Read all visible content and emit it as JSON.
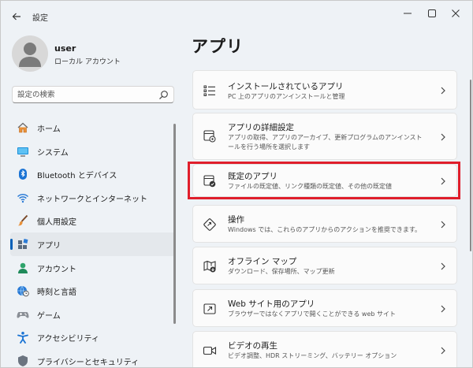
{
  "window": {
    "title": "設定"
  },
  "profile": {
    "name": "user",
    "account_type": "ローカル アカウント"
  },
  "search": {
    "placeholder": "設定の検索"
  },
  "sidebar": {
    "items": [
      {
        "label": "ホーム",
        "icon": "home-icon"
      },
      {
        "label": "システム",
        "icon": "monitor-icon"
      },
      {
        "label": "Bluetooth とデバイス",
        "icon": "bluetooth-icon"
      },
      {
        "label": "ネットワークとインターネット",
        "icon": "wifi-icon"
      },
      {
        "label": "個人用設定",
        "icon": "brush-icon"
      },
      {
        "label": "アプリ",
        "icon": "apps-icon",
        "active": true
      },
      {
        "label": "アカウント",
        "icon": "person-icon"
      },
      {
        "label": "時刻と言語",
        "icon": "globe-clock-icon"
      },
      {
        "label": "ゲーム",
        "icon": "gamepad-icon"
      },
      {
        "label": "アクセシビリティ",
        "icon": "accessibility-icon"
      },
      {
        "label": "プライバシーとセキュリティ",
        "icon": "shield-icon"
      }
    ]
  },
  "main": {
    "title": "アプリ",
    "cards": [
      {
        "title": "インストールされているアプリ",
        "desc": "PC 上のアプリのアンインストールと管理",
        "icon": "installed-apps-icon"
      },
      {
        "title": "アプリの詳細設定",
        "desc": "アプリの取得、アプリのアーカイブ、更新プログラムのアンインストールを行う場所を選択します",
        "icon": "advanced-app-settings-icon"
      },
      {
        "title": "既定のアプリ",
        "desc": "ファイルの既定値、リンク種類の既定値、その他の既定値",
        "icon": "default-apps-icon"
      },
      {
        "title": "操作",
        "desc": "Windows では、これらのアプリからのアクションを推奨できます。",
        "icon": "actions-icon"
      },
      {
        "title": "オフライン マップ",
        "desc": "ダウンロード、保存場所、マップ更新",
        "icon": "offline-map-icon"
      },
      {
        "title": "Web サイト用のアプリ",
        "desc": "ブラウザーではなくアプリで開くことができる web サイト",
        "icon": "web-apps-icon"
      },
      {
        "title": "ビデオの再生",
        "desc": "ビデオ調整、HDR ストリーミング、バッテリー オプション",
        "icon": "video-icon"
      }
    ]
  },
  "colors": {
    "accent": "#005fb8",
    "highlight": "#e01e2b"
  }
}
